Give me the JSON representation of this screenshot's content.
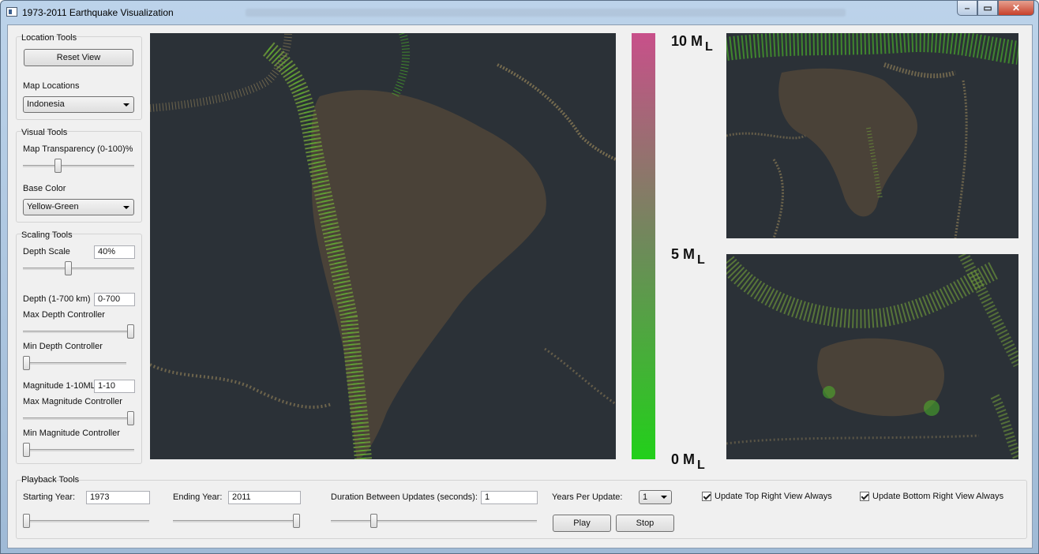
{
  "window": {
    "title": "1973-2011 Earthquake Visualization"
  },
  "location_tools": {
    "title": "Location Tools",
    "reset_view": "Reset View",
    "map_locations_label": "Map Locations",
    "map_location_value": "Indonesia"
  },
  "visual_tools": {
    "title": "Visual Tools",
    "transparency_label": "Map Transparency (0-100)%",
    "transparency_value": 0.3,
    "base_color_label": "Base Color",
    "base_color_value": "Yellow-Green"
  },
  "scaling_tools": {
    "title": "Scaling Tools",
    "depth_scale_label": "Depth Scale",
    "depth_scale_value": "40%",
    "depth_scale_slider": 0.4,
    "depth_label": "Depth (1-700 km)",
    "depth_value": "0-700",
    "max_depth_label": "Max Depth Controller",
    "max_depth_slider": 1.0,
    "min_depth_label": "Min Depth Controller",
    "min_depth_slider": 0.0,
    "magnitude_label": "Magnitude 1-10ML",
    "magnitude_value": "1-10",
    "max_magnitude_label": "Max Magnitude Controller",
    "max_magnitude_slider": 1.0,
    "min_magnitude_label": "Min Magnitude Controller",
    "min_magnitude_slider": 0.0
  },
  "legend": {
    "top_label": "10 M",
    "mid_label": "5 M",
    "bottom_label": "0 M",
    "unit_sub": "L",
    "color_top": "#c8508a",
    "color_bottom": "#22d01a"
  },
  "playback": {
    "title": "Playback Tools",
    "start_label": "Starting Year:",
    "start_value": "1973",
    "start_slider": 0.0,
    "end_label": "Ending Year:",
    "end_value": "2011",
    "end_slider": 1.0,
    "duration_label": "Duration Between Updates (seconds):",
    "duration_value": "1",
    "duration_slider": 0.2,
    "years_label": "Years Per Update:",
    "years_value": "1",
    "play": "Play",
    "stop": "Stop",
    "update_top": "Update Top Right View Always",
    "update_bottom": "Update Bottom Right View Always"
  },
  "maps": {
    "main": "South America",
    "top_right": "Africa",
    "bottom_right": "Australia",
    "quake_color": "#6da03a",
    "land_color": "#4a4238",
    "ocean_color": "#2b3137"
  }
}
